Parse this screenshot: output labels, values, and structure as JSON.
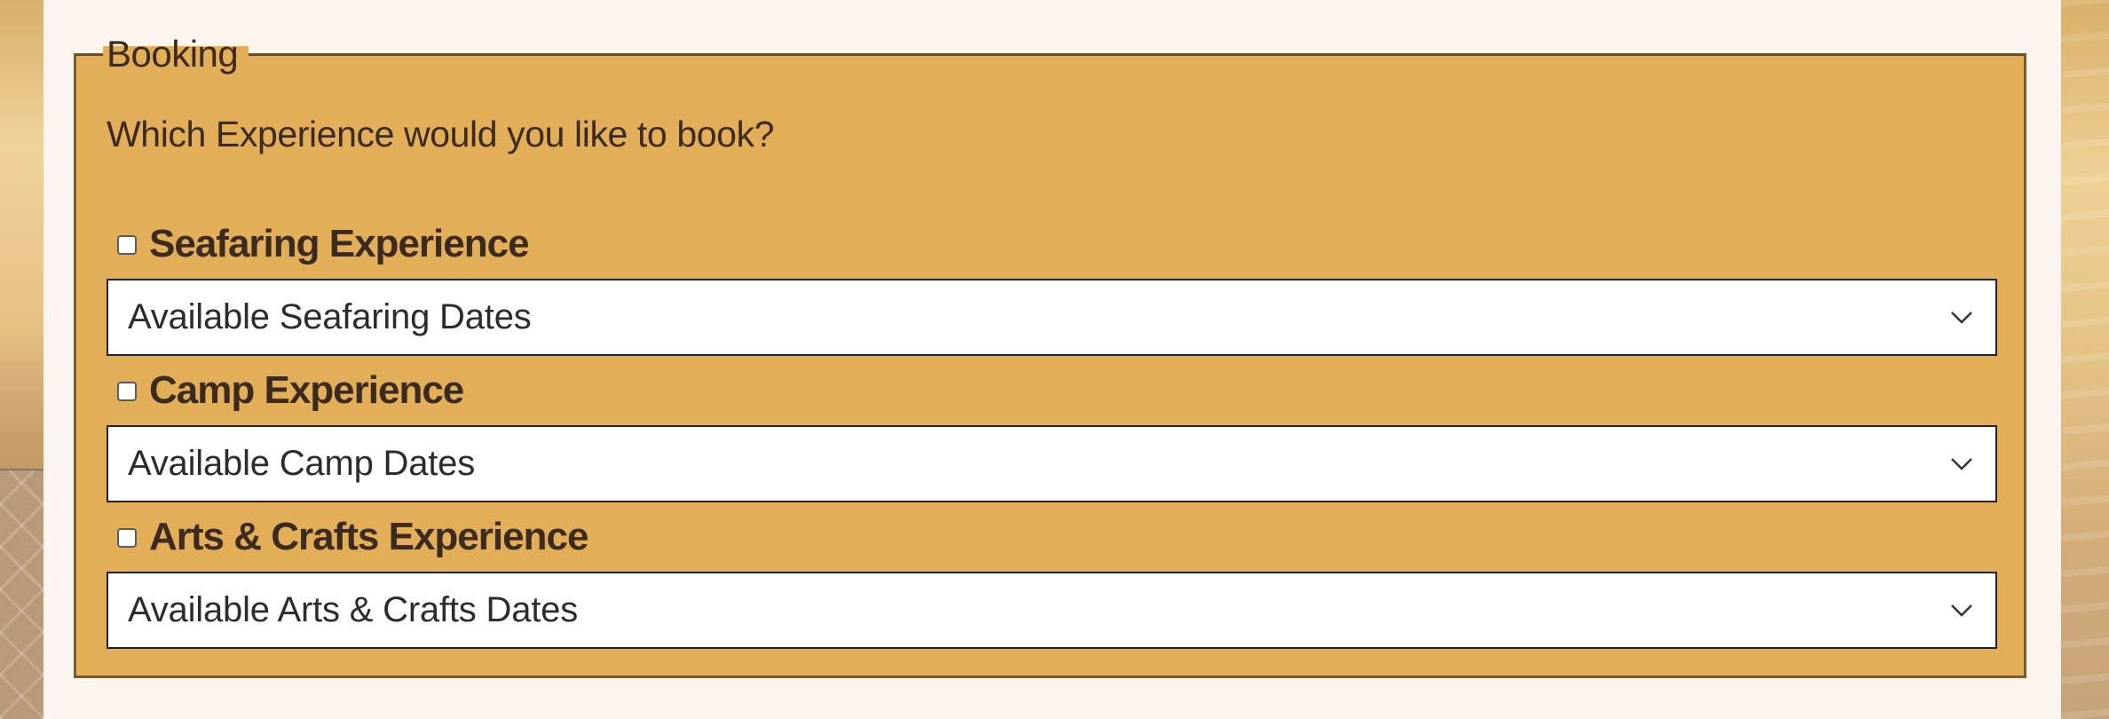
{
  "booking": {
    "legend": "Booking",
    "question": "Which Experience would you like to book?",
    "experiences": [
      {
        "label": "Seafaring Experience",
        "checked": false,
        "select_value": "Available Seafaring Dates"
      },
      {
        "label": "Camp Experience",
        "checked": false,
        "select_value": "Available Camp Dates"
      },
      {
        "label": "Arts & Crafts Experience",
        "checked": false,
        "select_value": "Available Arts & Crafts Dates"
      }
    ]
  },
  "colors": {
    "fieldset_background": "#e2ae57",
    "page_background": "#fdf5ef",
    "text": "#3a2a1f"
  },
  "icons": {
    "select_arrow": "chevron-down-icon"
  }
}
